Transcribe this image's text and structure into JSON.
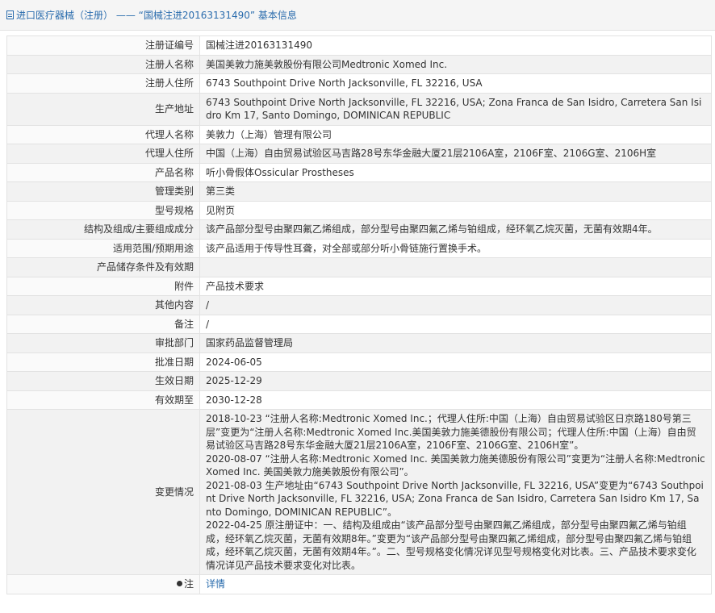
{
  "header": {
    "breadcrumb_section": "进口医疗器械（注册）",
    "separator": " —— ",
    "breadcrumb_title": "“国械注进20163131490” 基本信息"
  },
  "rows": [
    {
      "label": "注册证编号",
      "value": "国械注进20163131490"
    },
    {
      "label": "注册人名称",
      "value": "美国美敦力施美敦股份有限公司Medtronic Xomed Inc."
    },
    {
      "label": "注册人住所",
      "value": "6743 Southpoint Drive North Jacksonville, FL 32216, USA"
    },
    {
      "label": "生产地址",
      "value": "6743 Southpoint Drive North Jacksonville, FL 32216, USA; Zona Franca de San Isidro, Carretera San Isidro Km 17, Santo Domingo, DOMINICAN REPUBLIC"
    },
    {
      "label": "代理人名称",
      "value": "美敦力（上海）管理有限公司"
    },
    {
      "label": "代理人住所",
      "value": "中国（上海）自由贸易试验区马吉路28号东华金融大厦21层2106A室，2106F室、2106G室、2106H室"
    },
    {
      "label": "产品名称",
      "value": "听小骨假体Ossicular Prostheses"
    },
    {
      "label": "管理类别",
      "value": "第三类"
    },
    {
      "label": "型号规格",
      "value": "见附页"
    },
    {
      "label": "结构及组成/主要组成成分",
      "value": "该产品部分型号由聚四氟乙烯组成，部分型号由聚四氟乙烯与铂组成，经环氧乙烷灭菌，无菌有效期4年。"
    },
    {
      "label": "适用范围/预期用途",
      "value": "该产品适用于传导性耳聋，对全部或部分听小骨链施行置换手术。"
    },
    {
      "label": "产品储存条件及有效期",
      "value": ""
    },
    {
      "label": "附件",
      "value": "产品技术要求"
    },
    {
      "label": "其他内容",
      "value": "/"
    },
    {
      "label": "备注",
      "value": "/"
    },
    {
      "label": "审批部门",
      "value": "国家药品监督管理局"
    },
    {
      "label": "批准日期",
      "value": "2024-06-05"
    },
    {
      "label": "生效日期",
      "value": "2025-12-29"
    },
    {
      "label": "有效期至",
      "value": "2030-12-28"
    }
  ],
  "changes": {
    "label": "变更情况",
    "entries": [
      "2018-10-23 “注册人名称:Medtronic Xomed Inc.；代理人住所:中国（上海）自由贸易试验区日京路180号第三层”变更为“注册人名称:Medtronic Xomed Inc.美国美敦力施美德股份有限公司；代理人住所:中国（上海）自由贸易试验区马吉路28号东华金融大厦21层2106A室，2106F室、2106G室、2106H室”。",
      "2020-08-07 “注册人名称:Medtronic Xomed Inc. 美国美敦力施美德股份有限公司”变更为“注册人名称:Medtronic Xomed Inc. 美国美敦力施美敦股份有限公司”。",
      "2021-08-03 生产地址由“6743 Southpoint Drive North Jacksonville, FL 32216, USA”变更为“6743 Southpoint Drive North Jacksonville, FL 32216, USA; Zona Franca de San Isidro, Carretera San Isidro Km 17, Santo Domingo, DOMINICAN REPUBLIC”。",
      "2022-04-25 原注册证中：一、结构及组成由“该产品部分型号由聚四氟乙烯组成，部分型号由聚四氟乙烯与铂组成，经环氧乙烷灭菌，无菌有效期8年。”变更为“该产品部分型号由聚四氟乙烯组成，部分型号由聚四氟乙烯与铂组成，经环氧乙烷灭菌，无菌有效期4年。”。二、型号规格变化情况详见型号规格变化对比表。三、产品技术要求变化情况详见产品技术要求变化对比表。"
    ]
  },
  "note": {
    "label": "注",
    "icon": "pin-icon",
    "link_text": "详情"
  }
}
